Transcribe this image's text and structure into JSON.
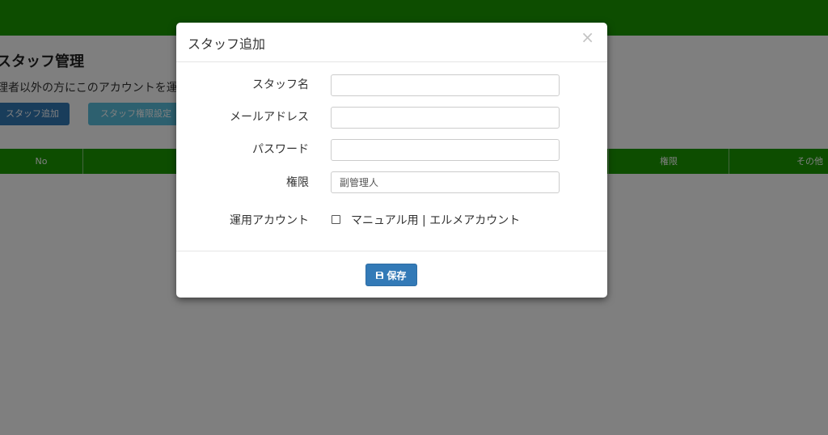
{
  "background_page": {
    "title": "スタッフ管理",
    "description": "理者以外の方にこのアカウントを運用",
    "buttons": {
      "add_staff": "スタッフ追加",
      "permission_settings": "スタッフ権限設定"
    },
    "table_headers": {
      "no": "No",
      "mid": "",
      "permission": "権限",
      "other": "その他"
    },
    "colors": {
      "header_green": "#1b9a00",
      "primary": "#337ab7",
      "info": "#5bc0de"
    }
  },
  "modal": {
    "title": "スタッフ追加",
    "close_icon": "×",
    "fields": {
      "staff_name": {
        "label": "スタッフ名",
        "value": ""
      },
      "email": {
        "label": "メールアドレス",
        "value": ""
      },
      "password": {
        "label": "パスワード",
        "value": ""
      },
      "permission": {
        "label": "権限",
        "value": "副管理人"
      },
      "account": {
        "label": "運用アカウント",
        "option_label": "マニュアル用 | エルメアカウント",
        "checked": false
      }
    },
    "save_label": "保存",
    "save_icon": "floppy-disk-icon"
  }
}
